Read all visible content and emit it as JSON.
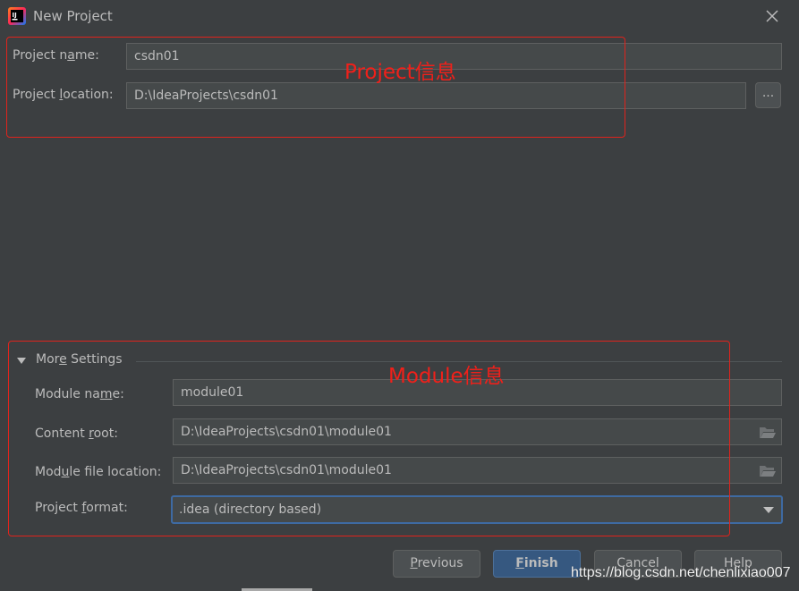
{
  "window": {
    "title": "New Project",
    "app_icon": "intellij-idea-icon",
    "close_icon": "close-icon"
  },
  "project": {
    "name_label_pre": "Project n",
    "name_label_mnemonic": "a",
    "name_label_post": "me:",
    "name_value": "csdn01",
    "location_label_pre": "Project ",
    "location_label_mnemonic": "l",
    "location_label_post": "ocation:",
    "location_value": "D:\\IdeaProjects\\csdn01",
    "browse_label": "..."
  },
  "more_settings": {
    "label_pre": "Mor",
    "label_mnemonic": "e",
    "label_post": " Settings",
    "expanded": true,
    "module_name_label_pre": "Module na",
    "module_name_label_mnemonic": "m",
    "module_name_label_post": "e:",
    "module_name_value": "module01",
    "content_root_label_pre": "Content ",
    "content_root_label_mnemonic": "r",
    "content_root_label_post": "oot:",
    "content_root_value": "D:\\IdeaProjects\\csdn01\\module01",
    "module_file_label_pre": "Mod",
    "module_file_label_mnemonic": "u",
    "module_file_label_post": "le file location:",
    "module_file_value": "D:\\IdeaProjects\\csdn01\\module01",
    "format_label_pre": "Project ",
    "format_label_mnemonic": "f",
    "format_label_post": "ormat:",
    "format_value": ".idea (directory based)"
  },
  "annotations": {
    "project_info": "Project信息",
    "module_info": "Module信息",
    "color": "#e0231c"
  },
  "buttons": {
    "previous_mnemonic": "P",
    "previous_rest": "revious",
    "finish_mnemonic": "F",
    "finish_rest": "inish",
    "cancel": "Cancel",
    "help": "Help"
  },
  "watermark": "https://blog.csdn.net/chenlixiao007",
  "colors": {
    "background": "#3c3f41",
    "field": "#45494a",
    "primary_button": "#365880",
    "focus_border": "#3e6aa2"
  }
}
